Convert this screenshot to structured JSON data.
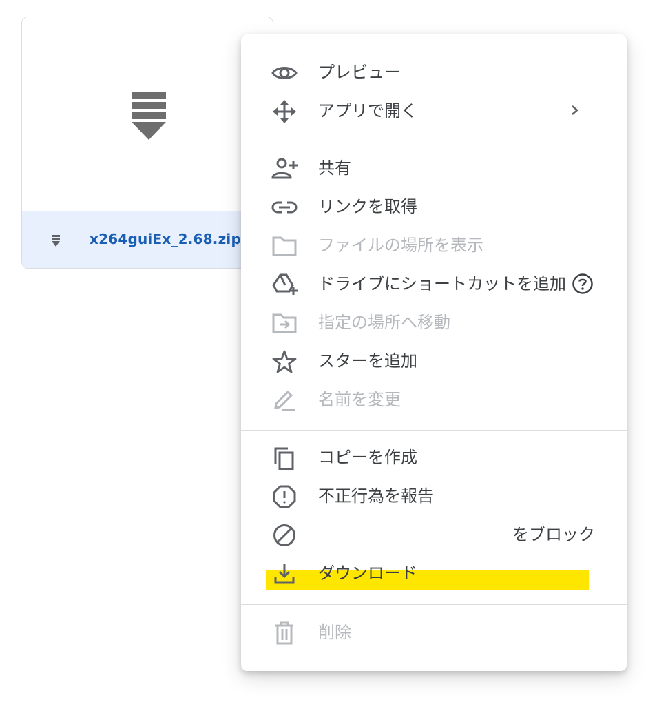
{
  "file_card": {
    "file_name": "x264guiEx_2.68.zip",
    "thumbnail_icon": "zip-archive-icon",
    "footer_icon": "zip-archive-icon"
  },
  "menu": {
    "items": [
      {
        "label": "プレビュー",
        "icon": "eye-icon",
        "disabled": false
      },
      {
        "label": "アプリで開く",
        "icon": "open-with-icon",
        "disabled": false,
        "submenu": true
      },
      {
        "label": "共有",
        "icon": "person-add-icon",
        "disabled": false
      },
      {
        "label": "リンクを取得",
        "icon": "link-icon",
        "disabled": false
      },
      {
        "label": "ファイルの場所を表示",
        "icon": "folder-icon",
        "disabled": true
      },
      {
        "label": "ドライブにショートカットを追加",
        "icon": "add-shortcut-icon",
        "disabled": false,
        "help": true
      },
      {
        "label": "指定の場所へ移動",
        "icon": "move-to-folder-icon",
        "disabled": true
      },
      {
        "label": "スターを追加",
        "icon": "star-icon",
        "disabled": false
      },
      {
        "label": "名前を変更",
        "icon": "pencil-icon",
        "disabled": true
      },
      {
        "label": "コピーを作成",
        "icon": "copy-icon",
        "disabled": false
      },
      {
        "label": "不正行為を報告",
        "icon": "report-icon",
        "disabled": false
      },
      {
        "label": "をブロック",
        "icon": "block-icon",
        "disabled": false
      },
      {
        "label": "ダウンロード",
        "icon": "download-icon",
        "disabled": false,
        "highlighted": true
      },
      {
        "label": "削除",
        "icon": "trash-icon",
        "disabled": true
      }
    ]
  },
  "colors": {
    "text": "#3c4043",
    "icon": "#5f6368",
    "disabled": "#b5b8bc",
    "highlight": "#ffe600",
    "file_name": "#1a5fb4",
    "footer_bg": "#e8f0fe"
  }
}
